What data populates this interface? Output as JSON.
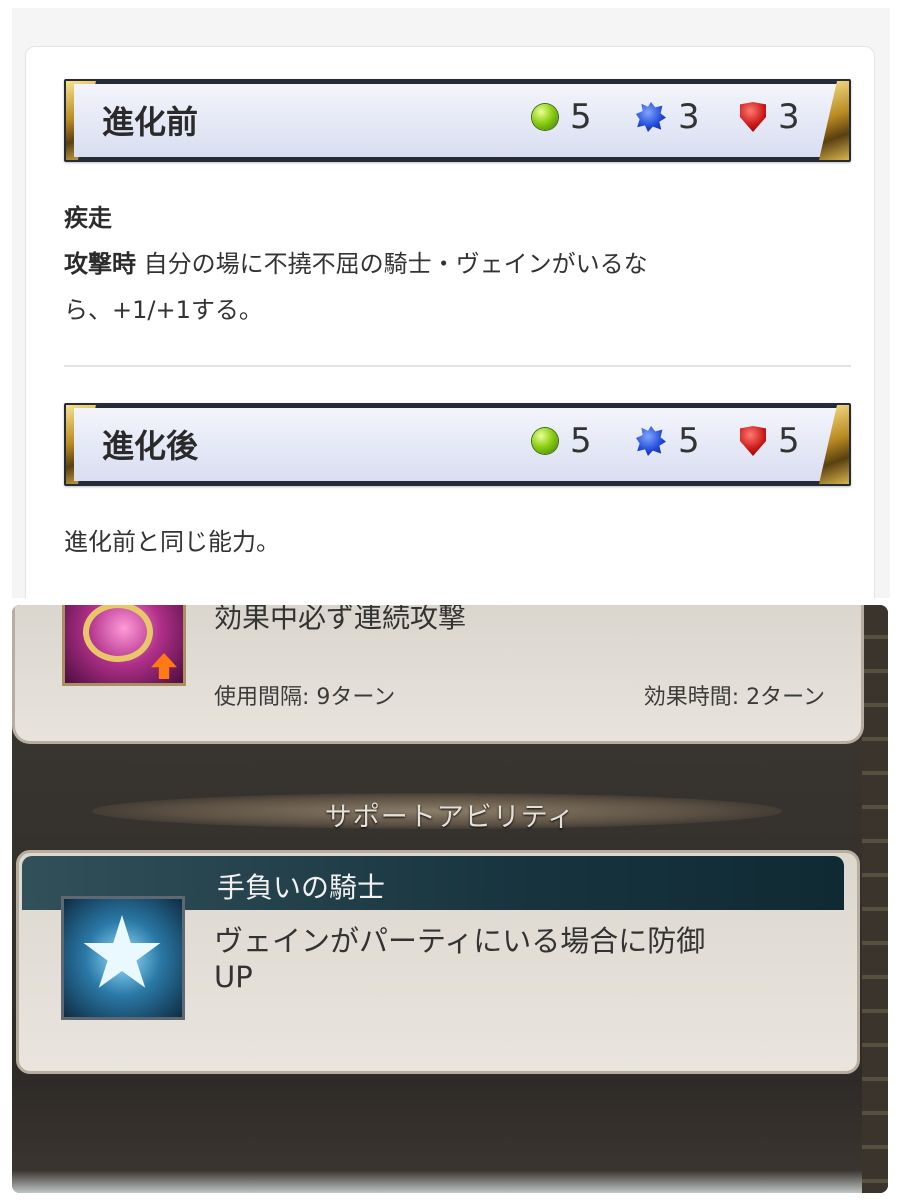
{
  "card": {
    "before": {
      "title": "進化前",
      "cost": "5",
      "attack": "3",
      "defense": "3",
      "keyword": "疾走",
      "trigger": "攻撃時",
      "effect_line1": "自分の場に不撓不屈の騎士・ヴェインがいるな",
      "effect_line2": "ら、+1/+1する。"
    },
    "after": {
      "title": "進化後",
      "cost": "5",
      "attack": "5",
      "defense": "5",
      "effect": "進化前と同じ能力。"
    },
    "icons": {
      "cost": "green-orb-icon",
      "attack": "blue-crystal-icon",
      "defense": "red-shield-icon"
    }
  },
  "game": {
    "skill": {
      "description": "効果中必ず連続攻撃",
      "interval": "使用間隔: 9ターン",
      "duration": "効果時間: 2ターン",
      "icon": "purple-gem-ring-icon"
    },
    "support_header": "サポートアビリティ",
    "ability": {
      "title": "手負いの騎士",
      "description_line1": "ヴェインがパーティにいる場合に防御",
      "description_line2": "UP",
      "icon": "star-icon"
    }
  },
  "colors": {
    "bar_frame": "#262b38",
    "bar_fill": "#e4e8f6",
    "ability_title_bar": "#17343f",
    "game_background": "#2b2825"
  }
}
